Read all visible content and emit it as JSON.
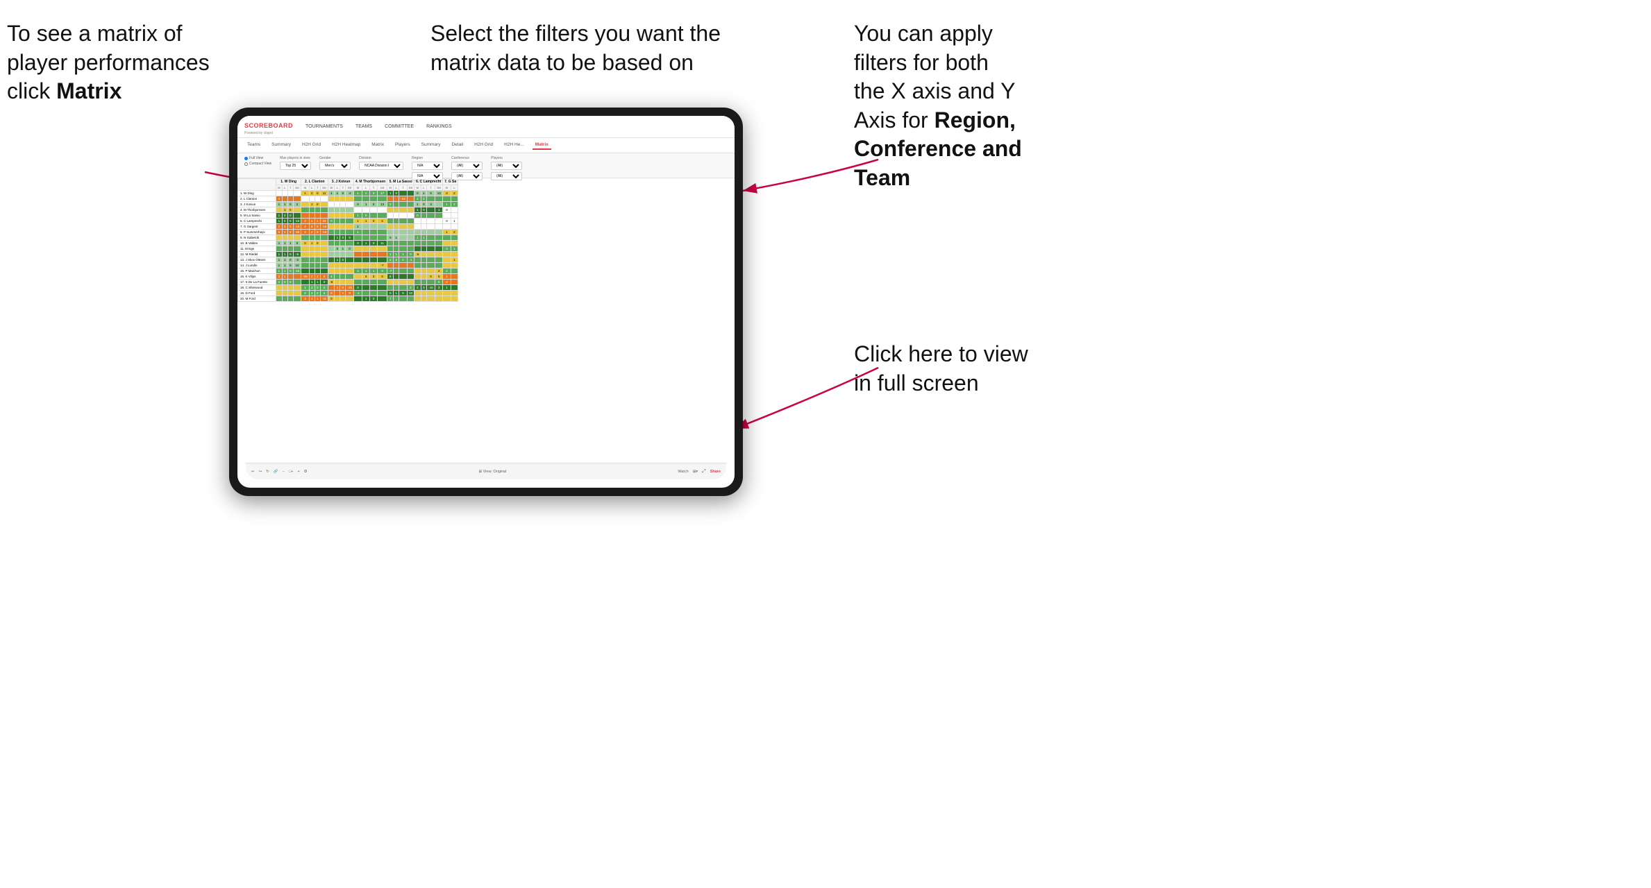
{
  "annotations": {
    "topleft": {
      "line1": "To see a matrix of",
      "line2": "player performances",
      "line3_prefix": "click ",
      "line3_bold": "Matrix"
    },
    "topmid": {
      "text": "Select the filters you want the matrix data to be based on"
    },
    "topright": {
      "line1": "You  can apply",
      "line2": "filters for both",
      "line3": "the X axis and Y",
      "line4_prefix": "Axis for ",
      "line4_bold": "Region,",
      "line5_bold": "Conference and",
      "line6_bold": "Team"
    },
    "bottomright": {
      "line1": "Click here to view",
      "line2": "in full screen"
    }
  },
  "app": {
    "logo": "SCOREBOARD",
    "logo_sub": "Powered by clippd",
    "nav_items": [
      "TOURNAMENTS",
      "TEAMS",
      "COMMITTEE",
      "RANKINGS"
    ],
    "sub_nav_items": [
      "Teams",
      "Summary",
      "H2H Grid",
      "H2H Heatmap",
      "Matrix",
      "Players",
      "Summary",
      "Detail",
      "H2H Grid",
      "H2H He...",
      "Matrix"
    ],
    "active_sub_nav": "Matrix"
  },
  "filters": {
    "view_options": [
      "Full View",
      "Compact View"
    ],
    "max_players_label": "Max players in view",
    "max_players_value": "Top 25",
    "gender_label": "Gender",
    "gender_value": "Men's",
    "division_label": "Division",
    "division_value": "NCAA Division I",
    "region_label": "Region",
    "region_value": "N/A",
    "conference_label": "Conference",
    "conference_value1": "(All)",
    "conference_value2": "(All)",
    "players_label": "Players",
    "players_value1": "(All)",
    "players_value2": "(All)"
  },
  "matrix": {
    "col_headers": [
      "1. W Ding",
      "2. L Clanton",
      "3. J Koivun",
      "4. M Thorbjornsen",
      "5. M La Sasso",
      "6. C Lamprecht",
      "7. G Sa"
    ],
    "col_subheaders": [
      "W",
      "L",
      "T",
      "Dif"
    ],
    "rows": [
      {
        "name": "1. W Ding",
        "cells": [
          [
            "",
            "",
            "",
            "",
            "1",
            "2",
            "0",
            "11"
          ],
          [
            "1",
            "1",
            "0",
            "-2"
          ],
          [
            "1",
            "2",
            "0",
            "17"
          ],
          [
            "1",
            "0",
            "",
            ""
          ],
          [
            "0",
            "1",
            "0",
            "13"
          ],
          [
            "0",
            "2",
            ""
          ]
        ]
      },
      {
        "name": "2. L Clanton",
        "cells": [
          [
            "2",
            "",
            "",
            "-16"
          ],
          [
            "",
            "",
            "",
            ""
          ],
          [
            "",
            "",
            "",
            ""
          ],
          [
            "",
            "",
            "",
            ""
          ],
          [
            "",
            "",
            "-24"
          ],
          [
            "2",
            "2",
            ""
          ]
        ]
      },
      {
        "name": "3. J Koivun"
      },
      {
        "name": "4. M Thorbjornsen"
      },
      {
        "name": "5. M La Sasso"
      },
      {
        "name": "6. C Lamprecht"
      },
      {
        "name": "7. G Sargent"
      },
      {
        "name": "8. P Summerhays"
      },
      {
        "name": "9. N Gabelcik"
      },
      {
        "name": "10. B Valdes"
      },
      {
        "name": "11. M Ege"
      },
      {
        "name": "12. M Riedel"
      },
      {
        "name": "13. J Skov Olesen"
      },
      {
        "name": "14. J Lundin"
      },
      {
        "name": "15. P Maichon"
      },
      {
        "name": "16. K Vilips"
      },
      {
        "name": "17. S De La Fuente"
      },
      {
        "name": "18. C Sherwood"
      },
      {
        "name": "19. D Ford"
      },
      {
        "name": "20. M Ford"
      }
    ]
  },
  "bottom_bar": {
    "view_label": "View: Original",
    "watch_label": "Watch",
    "share_label": "Share"
  }
}
